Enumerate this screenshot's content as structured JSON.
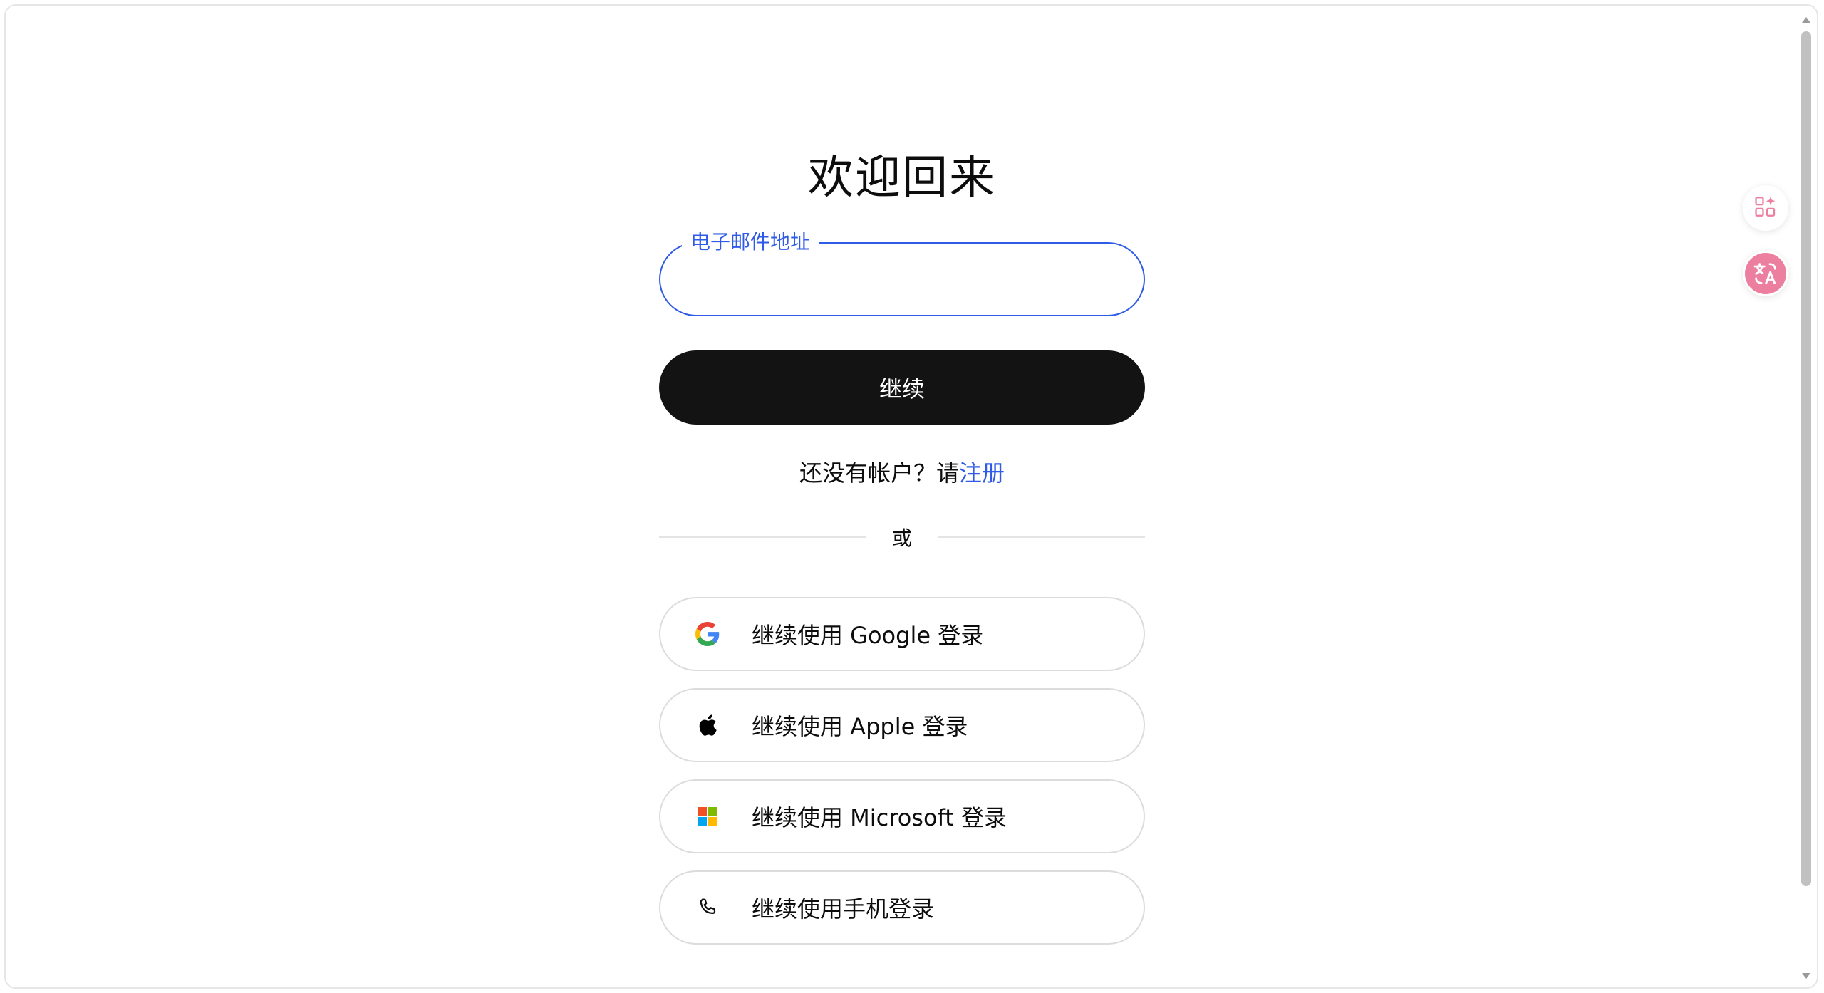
{
  "page": {
    "title": "欢迎回来"
  },
  "email": {
    "label": "电子邮件地址",
    "value": ""
  },
  "continue_button": {
    "label": "继续"
  },
  "signup": {
    "prompt": "还没有帐户？请",
    "link": "注册"
  },
  "divider": {
    "text": "或"
  },
  "social": [
    {
      "label": "继续使用 Google 登录",
      "icon": "google-icon"
    },
    {
      "label": "继续使用 Apple 登录",
      "icon": "apple-icon"
    },
    {
      "label": "继续使用 Microsoft 登录",
      "icon": "microsoft-icon"
    },
    {
      "label": "继续使用手机登录",
      "icon": "phone-icon"
    }
  ],
  "side_tools": [
    {
      "icon": "apps-sparkle-icon"
    },
    {
      "icon": "translate-icon"
    }
  ],
  "colors": {
    "accent": "#2f5be6",
    "button_dark": "#131313",
    "translate_pink": "#ec7f9f"
  }
}
